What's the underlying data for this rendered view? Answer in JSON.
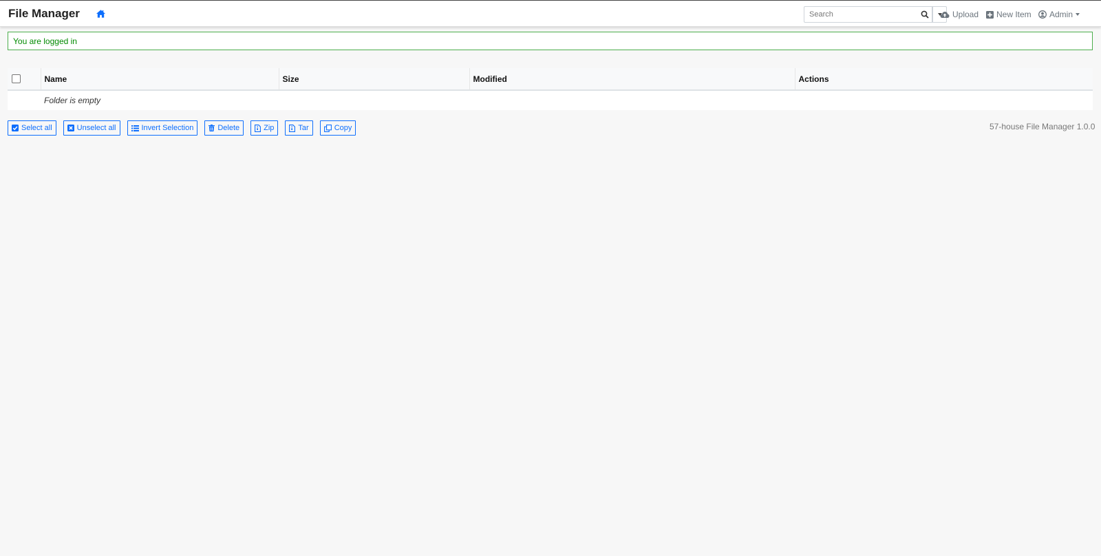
{
  "header": {
    "title": "File Manager",
    "home_icon": "home-icon",
    "search_placeholder": "Search",
    "upload_label": "Upload",
    "new_item_label": "New Item",
    "admin_label": "Admin"
  },
  "alert": {
    "message": "You are logged in",
    "color": "#008a00"
  },
  "table": {
    "columns": [
      "Name",
      "Size",
      "Modified",
      "Actions"
    ],
    "empty_message": "Folder is empty"
  },
  "actions": {
    "select_all": "Select all",
    "unselect_all": "Unselect all",
    "invert_selection": "Invert Selection",
    "delete": "Delete",
    "zip": "Zip",
    "tar": "Tar",
    "copy": "Copy"
  },
  "footer": {
    "version": "57-house File Manager 1.0.0"
  },
  "colors": {
    "accent": "#0d6efd",
    "muted": "#6c757d"
  }
}
